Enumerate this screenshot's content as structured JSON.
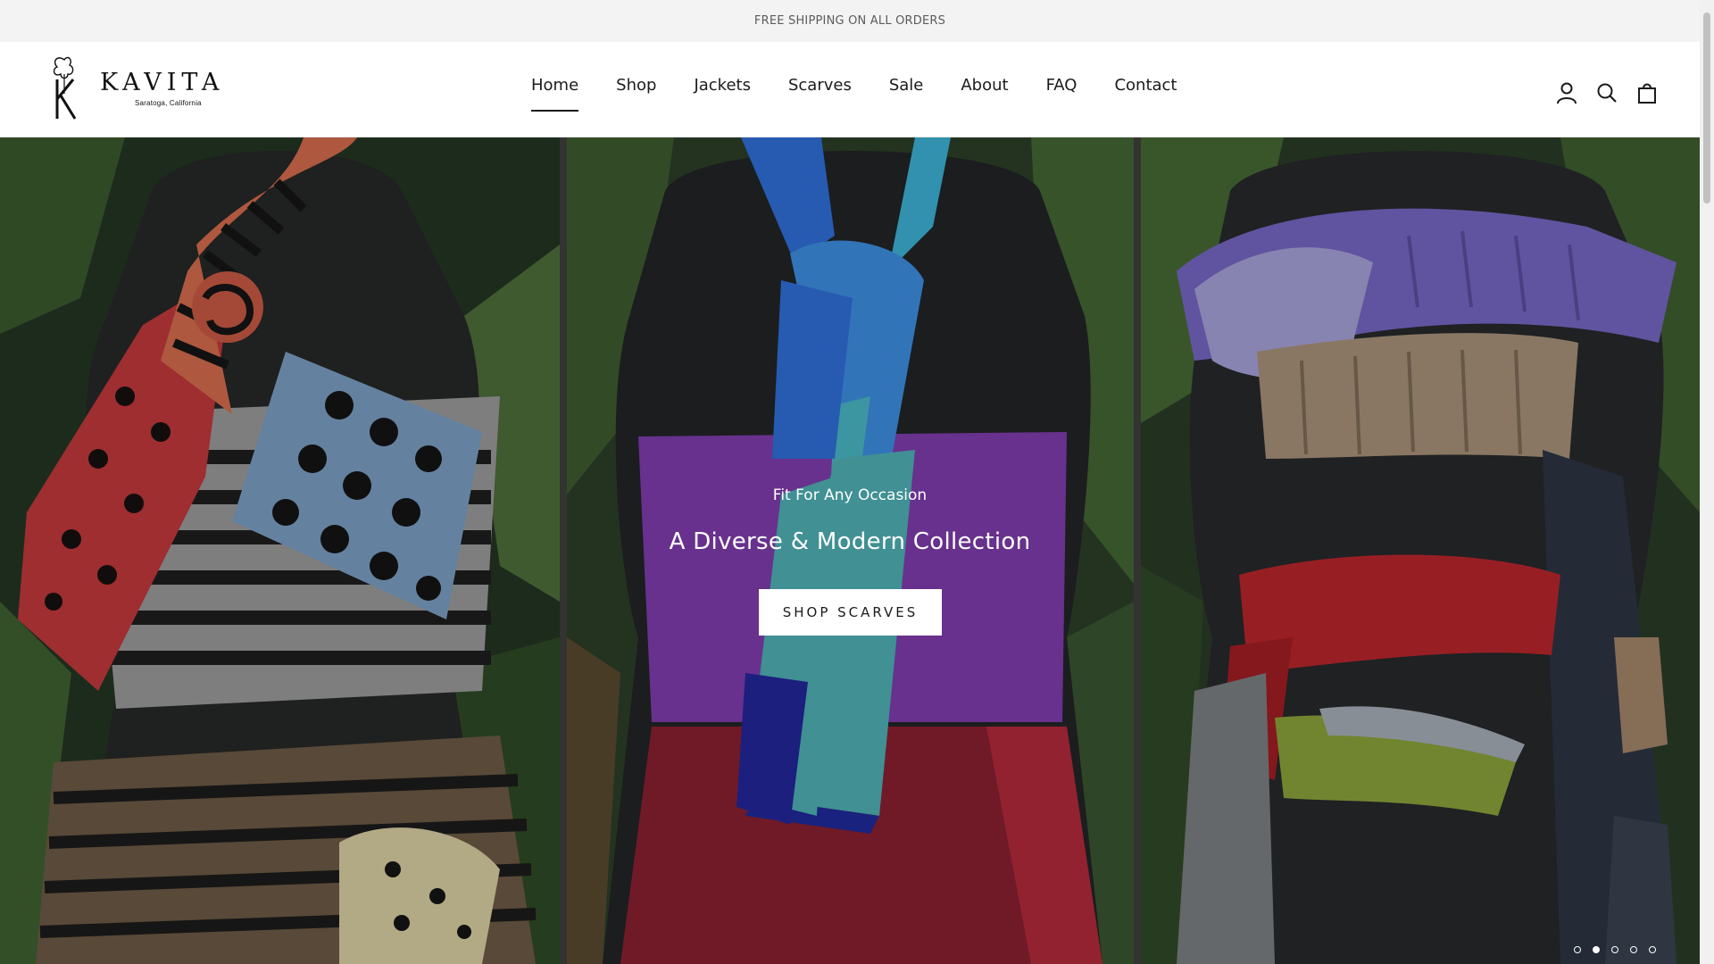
{
  "announcement": {
    "text": "FREE SHIPPING ON ALL ORDERS"
  },
  "brand": {
    "name": "KAVITA",
    "location": "Saratoga, California"
  },
  "nav": {
    "items": [
      {
        "label": "Home",
        "active": true
      },
      {
        "label": "Shop",
        "active": false
      },
      {
        "label": "Jackets",
        "active": false
      },
      {
        "label": "Scarves",
        "active": false
      },
      {
        "label": "Sale",
        "active": false
      },
      {
        "label": "About",
        "active": false
      },
      {
        "label": "FAQ",
        "active": false
      },
      {
        "label": "Contact",
        "active": false
      }
    ]
  },
  "header_icons": [
    "account-icon",
    "search-icon",
    "cart-icon"
  ],
  "hero": {
    "subtitle": "Fit For Any Occasion",
    "title": "A Diverse & Modern Collection",
    "button_label": "SHOP SCARVES",
    "slides_total": 5,
    "active_slide": 2
  },
  "colors": {
    "announcement_bg": "#f3f3f3",
    "text_dark": "#1c1b1b",
    "button_bg": "#ffffff"
  }
}
